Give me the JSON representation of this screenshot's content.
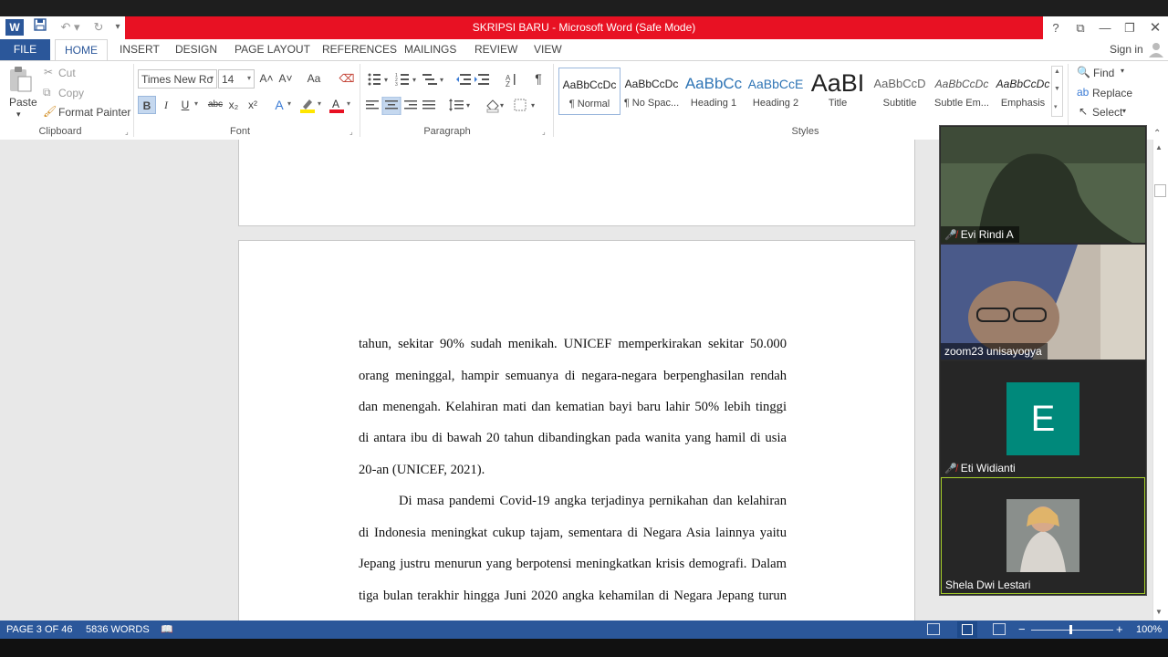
{
  "window": {
    "title": "SKRIPSI BARU -  Microsoft Word (Safe Mode)",
    "help_icon": "?",
    "sign_in": "Sign in"
  },
  "tabs": [
    "FILE",
    "HOME",
    "INSERT",
    "DESIGN",
    "PAGE LAYOUT",
    "REFERENCES",
    "MAILINGS",
    "REVIEW",
    "VIEW"
  ],
  "clipboard": {
    "paste": "Paste",
    "cut": "Cut",
    "copy": "Copy",
    "format_painter": "Format Painter",
    "group_label": "Clipboard"
  },
  "font": {
    "name": "Times New Ro",
    "size": "14",
    "group_label": "Font",
    "bold": "B",
    "italic": "I",
    "underline": "U",
    "strike": "abc",
    "subscript": "x₂",
    "superscript": "x²",
    "grow": "A˄",
    "shrink": "A˅",
    "case": "Aa"
  },
  "paragraph": {
    "group_label": "Paragraph",
    "pilcrow": "¶"
  },
  "styles": {
    "group_label": "Styles",
    "items": [
      {
        "preview": "AaBbCcDc",
        "name": "¶ Normal"
      },
      {
        "preview": "AaBbCcDc",
        "name": "¶ No Spac..."
      },
      {
        "preview": "AaBbCc",
        "name": "Heading 1"
      },
      {
        "preview": "AaBbCcE",
        "name": "Heading 2"
      },
      {
        "preview": "AaBI",
        "name": "Title"
      },
      {
        "preview": "AaBbCcD",
        "name": "Subtitle"
      },
      {
        "preview": "AaBbCcDc",
        "name": "Subtle Em..."
      },
      {
        "preview": "AaBbCcDc",
        "name": "Emphasis"
      }
    ]
  },
  "editing": {
    "find": "Find",
    "replace": "Replace",
    "select": "Select"
  },
  "document": {
    "lines": [
      "tahun, sekitar 90% sudah menikah. UNICEF memperkirakan sekitar 50.000",
      "orang meninggal, hampir semuanya di negara-negara berpenghasilan rendah",
      "dan menengah. Kelahiran mati dan kematian bayi baru lahir 50% lebih tinggi",
      "di antara ibu di bawah 20 tahun dibandingkan pada wanita yang hamil di usia",
      "20-an (UNICEF, 2021).",
      "Di masa pandemi Covid-19 angka terjadinya pernikahan dan kelahiran",
      "di Indonesia meningkat cukup tajam, sementara di Negara Asia lainnya yaitu",
      "Jepang justru menurun yang berpotensi meningkatkan krisis demografi. Dalam",
      "tiga bulan terakhir hingga Juni 2020 angka kehamilan di Negara Jepang turun"
    ]
  },
  "status": {
    "page": "PAGE 3 OF 46",
    "words": "5836 WORDS",
    "zoom": "100%"
  },
  "zoom_meeting": {
    "participants": [
      {
        "name": "Evi Rindi A",
        "muted": true,
        "video": true
      },
      {
        "name": "zoom23 unisayogya",
        "muted": false,
        "video": true
      },
      {
        "name": "Eti Widianti",
        "muted": true,
        "video": false,
        "initial": "E"
      },
      {
        "name": "Shela Dwi Lestari",
        "muted": false,
        "video": true,
        "active_speaker": true
      }
    ]
  },
  "colors": {
    "title_red": "#e81123",
    "word_blue": "#2b579a",
    "avatar_teal": "#00897b",
    "active_speaker": "#a8d12a"
  }
}
